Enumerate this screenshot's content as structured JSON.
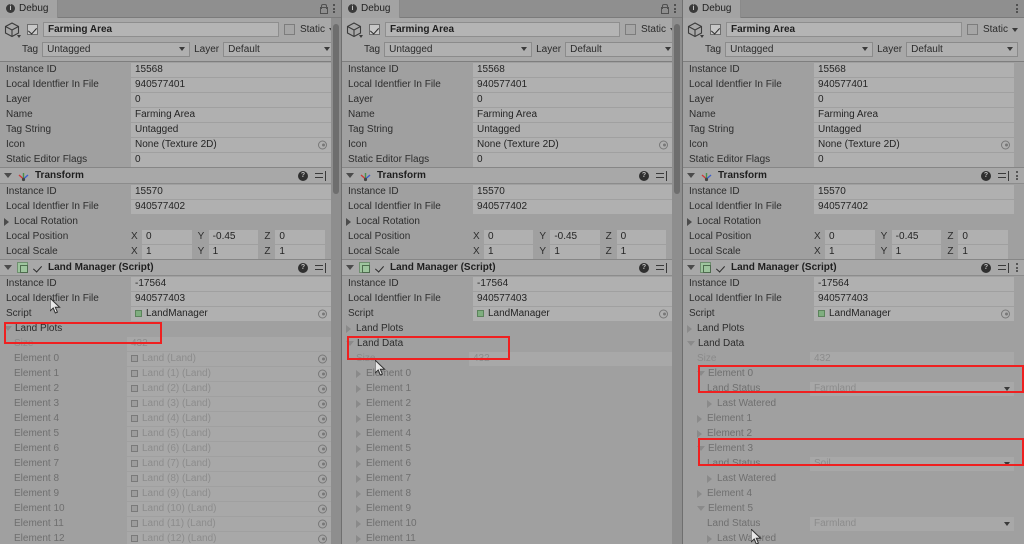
{
  "window": {
    "tab_label": "Debug",
    "lock_icon": "lock-icon",
    "menu_icon": "kebab-menu-icon"
  },
  "gameobject": {
    "name": "Farming Area",
    "enabled": true,
    "static_label": "Static",
    "static_checked": false,
    "tag_label": "Tag",
    "tag_value": "Untagged",
    "layer_label": "Layer",
    "layer_value": "Default"
  },
  "gameobject_props": [
    {
      "label": "Instance ID",
      "value": "15568"
    },
    {
      "label": "Local Identfier In File",
      "value": "940577401"
    },
    {
      "label": "Layer",
      "value": "0"
    },
    {
      "label": "Name",
      "value": "Farming Area"
    },
    {
      "label": "Tag String",
      "value": "Untagged"
    },
    {
      "label": "Icon",
      "value": "None (Texture 2D)",
      "object_field": true
    },
    {
      "label": "Static Editor Flags",
      "value": "0"
    }
  ],
  "transform": {
    "title": "Transform",
    "icon": "transform-axis-icon",
    "props": [
      {
        "label": "Instance ID",
        "value": "15570"
      },
      {
        "label": "Local Identfier In File",
        "value": "940577402"
      }
    ],
    "local_rotation_label": "Local Rotation",
    "local_position_label": "Local Position",
    "local_position": {
      "x": "0",
      "y": "-0.45",
      "z": "0"
    },
    "local_scale_label": "Local Scale",
    "local_scale": {
      "x": "1",
      "y": "1",
      "z": "1"
    },
    "axis_labels": {
      "x": "X",
      "y": "Y",
      "z": "Z"
    }
  },
  "land_manager": {
    "title": "Land Manager (Script)",
    "enabled": true,
    "props": [
      {
        "label": "Instance ID",
        "value": "-17564"
      },
      {
        "label": "Local Identfier In File",
        "value": "940577403"
      }
    ],
    "script_label": "Script",
    "script_value": "LandManager",
    "land_plots_label": "Land Plots",
    "land_data_label": "Land Data",
    "size_label": "Size",
    "size_value": "432"
  },
  "panel_left": {
    "land_plots_expanded": true,
    "elements": [
      {
        "label": "Element 0",
        "value": "Land (Land)"
      },
      {
        "label": "Element 1",
        "value": "Land (1) (Land)"
      },
      {
        "label": "Element 2",
        "value": "Land (2) (Land)"
      },
      {
        "label": "Element 3",
        "value": "Land (3) (Land)"
      },
      {
        "label": "Element 4",
        "value": "Land (4) (Land)"
      },
      {
        "label": "Element 5",
        "value": "Land (5) (Land)"
      },
      {
        "label": "Element 6",
        "value": "Land (6) (Land)"
      },
      {
        "label": "Element 7",
        "value": "Land (7) (Land)"
      },
      {
        "label": "Element 8",
        "value": "Land (8) (Land)"
      },
      {
        "label": "Element 9",
        "value": "Land (9) (Land)"
      },
      {
        "label": "Element 10",
        "value": "Land (10) (Land)"
      },
      {
        "label": "Element 11",
        "value": "Land (11) (Land)"
      },
      {
        "label": "Element 12",
        "value": "Land (12) (Land)"
      }
    ]
  },
  "panel_middle": {
    "land_plots_expanded": false,
    "land_data_expanded": true,
    "elements": [
      {
        "label": "Element 0"
      },
      {
        "label": "Element 1"
      },
      {
        "label": "Element 2"
      },
      {
        "label": "Element 3"
      },
      {
        "label": "Element 4"
      },
      {
        "label": "Element 5"
      },
      {
        "label": "Element 6"
      },
      {
        "label": "Element 7"
      },
      {
        "label": "Element 8"
      },
      {
        "label": "Element 9"
      },
      {
        "label": "Element 10"
      },
      {
        "label": "Element 11"
      }
    ]
  },
  "panel_right": {
    "land_plots_expanded": false,
    "land_data_expanded": true,
    "land_status_label": "Land Status",
    "last_watered_label": "Last Watered",
    "elements": [
      {
        "label": "Element 0",
        "expanded": true,
        "land_status": "Farmland"
      },
      {
        "label": "Element 1",
        "expanded": false
      },
      {
        "label": "Element 2",
        "expanded": false
      },
      {
        "label": "Element 3",
        "expanded": true,
        "land_status": "Soil"
      },
      {
        "label": "Element 4",
        "expanded": false
      },
      {
        "label": "Element 5",
        "expanded": true,
        "land_status": "Farmland"
      }
    ]
  },
  "annotations": {
    "highlight_color": "#ef2020",
    "boxes": [
      {
        "panel": "left",
        "target": "land-plots-size"
      },
      {
        "panel": "middle",
        "target": "land-data-size"
      },
      {
        "panel": "right",
        "target": "element-0-land-status"
      },
      {
        "panel": "right",
        "target": "element-3-land-status"
      }
    ]
  }
}
